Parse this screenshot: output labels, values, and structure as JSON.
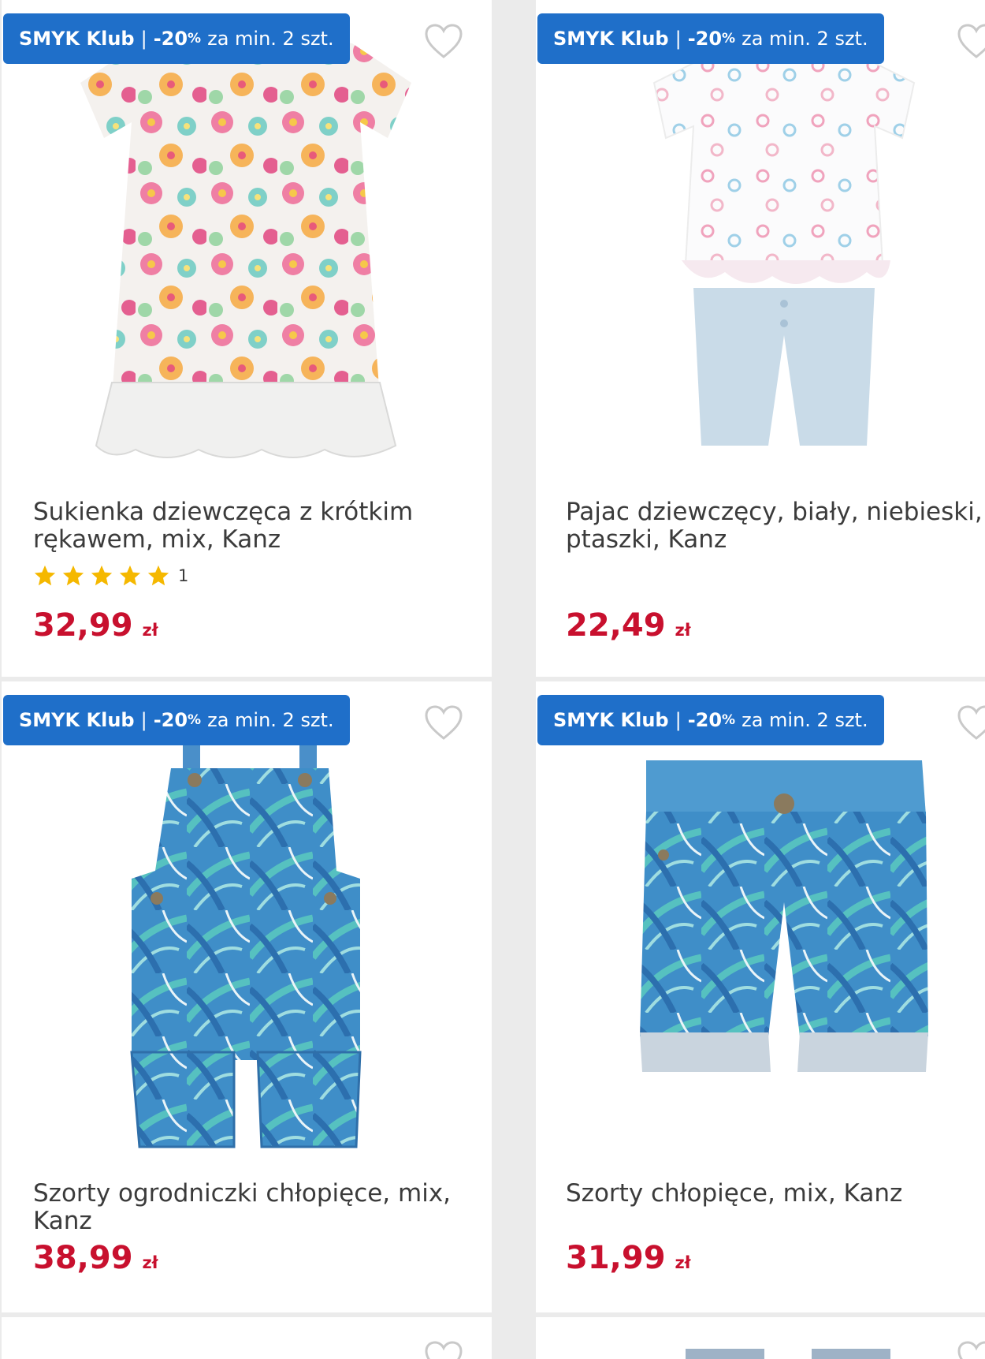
{
  "colors": {
    "badge_bg": "#1f6fc9",
    "price": "#c8102e",
    "star": "#f5b800",
    "page_bg": "#ebebeb"
  },
  "products": [
    {
      "badge": {
        "club": "SMYK Klub",
        "separator": "|",
        "discount": "-20",
        "percent": "%",
        "condition": "za min. 2 szt."
      },
      "title": "Sukienka dziewczęca z krótkim rękawem, mix, Kanz",
      "rating": {
        "stars": 5,
        "count": "1"
      },
      "price": {
        "value": "32,99",
        "currency": "zł"
      },
      "image_icon": "floral-dress-icon",
      "wishlist_icon": "heart-outline-icon"
    },
    {
      "badge": {
        "club": "SMYK Klub",
        "separator": "|",
        "discount": "-20",
        "percent": "%",
        "condition": "za min. 2 szt."
      },
      "title": "Pajac dziewczęcy, biały, niebieski, ptaszki, Kanz",
      "price": {
        "value": "22,49",
        "currency": "zł"
      },
      "image_icon": "romper-icon",
      "wishlist_icon": "heart-outline-icon"
    },
    {
      "badge": {
        "club": "SMYK Klub",
        "separator": "|",
        "discount": "-20",
        "percent": "%",
        "condition": "za min. 2 szt."
      },
      "title": "Szorty ogrodniczki chłopięce, mix, Kanz",
      "price": {
        "value": "38,99",
        "currency": "zł"
      },
      "image_icon": "overall-shorts-icon",
      "wishlist_icon": "heart-outline-icon"
    },
    {
      "badge": {
        "club": "SMYK Klub",
        "separator": "|",
        "discount": "-20",
        "percent": "%",
        "condition": "za min. 2 szt."
      },
      "title": "Szorty chłopięce, mix, Kanz",
      "price": {
        "value": "31,99",
        "currency": "zł"
      },
      "image_icon": "shorts-icon",
      "wishlist_icon": "heart-outline-icon"
    }
  ]
}
